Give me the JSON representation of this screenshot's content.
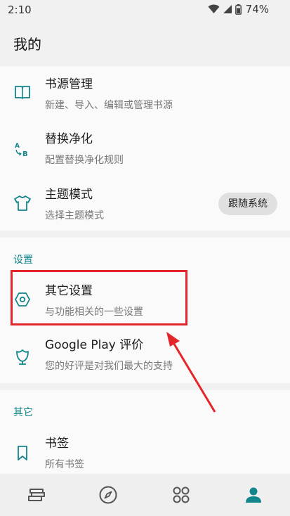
{
  "status_bar": {
    "time": "2:10",
    "battery": "74%",
    "icons": [
      "wifi-icon",
      "signal-icon",
      "battery-icon"
    ]
  },
  "app_bar": {
    "title": "我的"
  },
  "main_items": [
    {
      "icon": "book-icon",
      "title": "书源管理",
      "subtitle": "新建、导入、编辑或管理书源"
    },
    {
      "icon": "replace-icon",
      "title": "替换净化",
      "subtitle": "配置替换净化规则"
    },
    {
      "icon": "shirt-icon",
      "title": "主题模式",
      "subtitle": "选择主题模式",
      "value": "跟随系统"
    }
  ],
  "settings_section": {
    "label": "设置",
    "items": [
      {
        "icon": "hexagon-icon",
        "title": "其它设置",
        "subtitle": "与功能相关的一些设置"
      },
      {
        "icon": "flower-icon",
        "title": "Google Play 评价",
        "subtitle": "您的好评是对我们最大的支持"
      }
    ]
  },
  "other_section": {
    "label": "其它",
    "items": [
      {
        "icon": "bookmark-icon",
        "title": "书签",
        "subtitle": "所有书签"
      }
    ]
  },
  "bottom_nav": [
    {
      "icon": "bookshelf-icon",
      "active": false
    },
    {
      "icon": "compass-icon",
      "active": false
    },
    {
      "icon": "grid-icon",
      "active": false
    },
    {
      "icon": "person-icon",
      "active": true
    }
  ],
  "colors": {
    "accent": "#12868b",
    "highlight": "#e3262c",
    "background": "#f1f1f1",
    "card": "#fafafa"
  }
}
